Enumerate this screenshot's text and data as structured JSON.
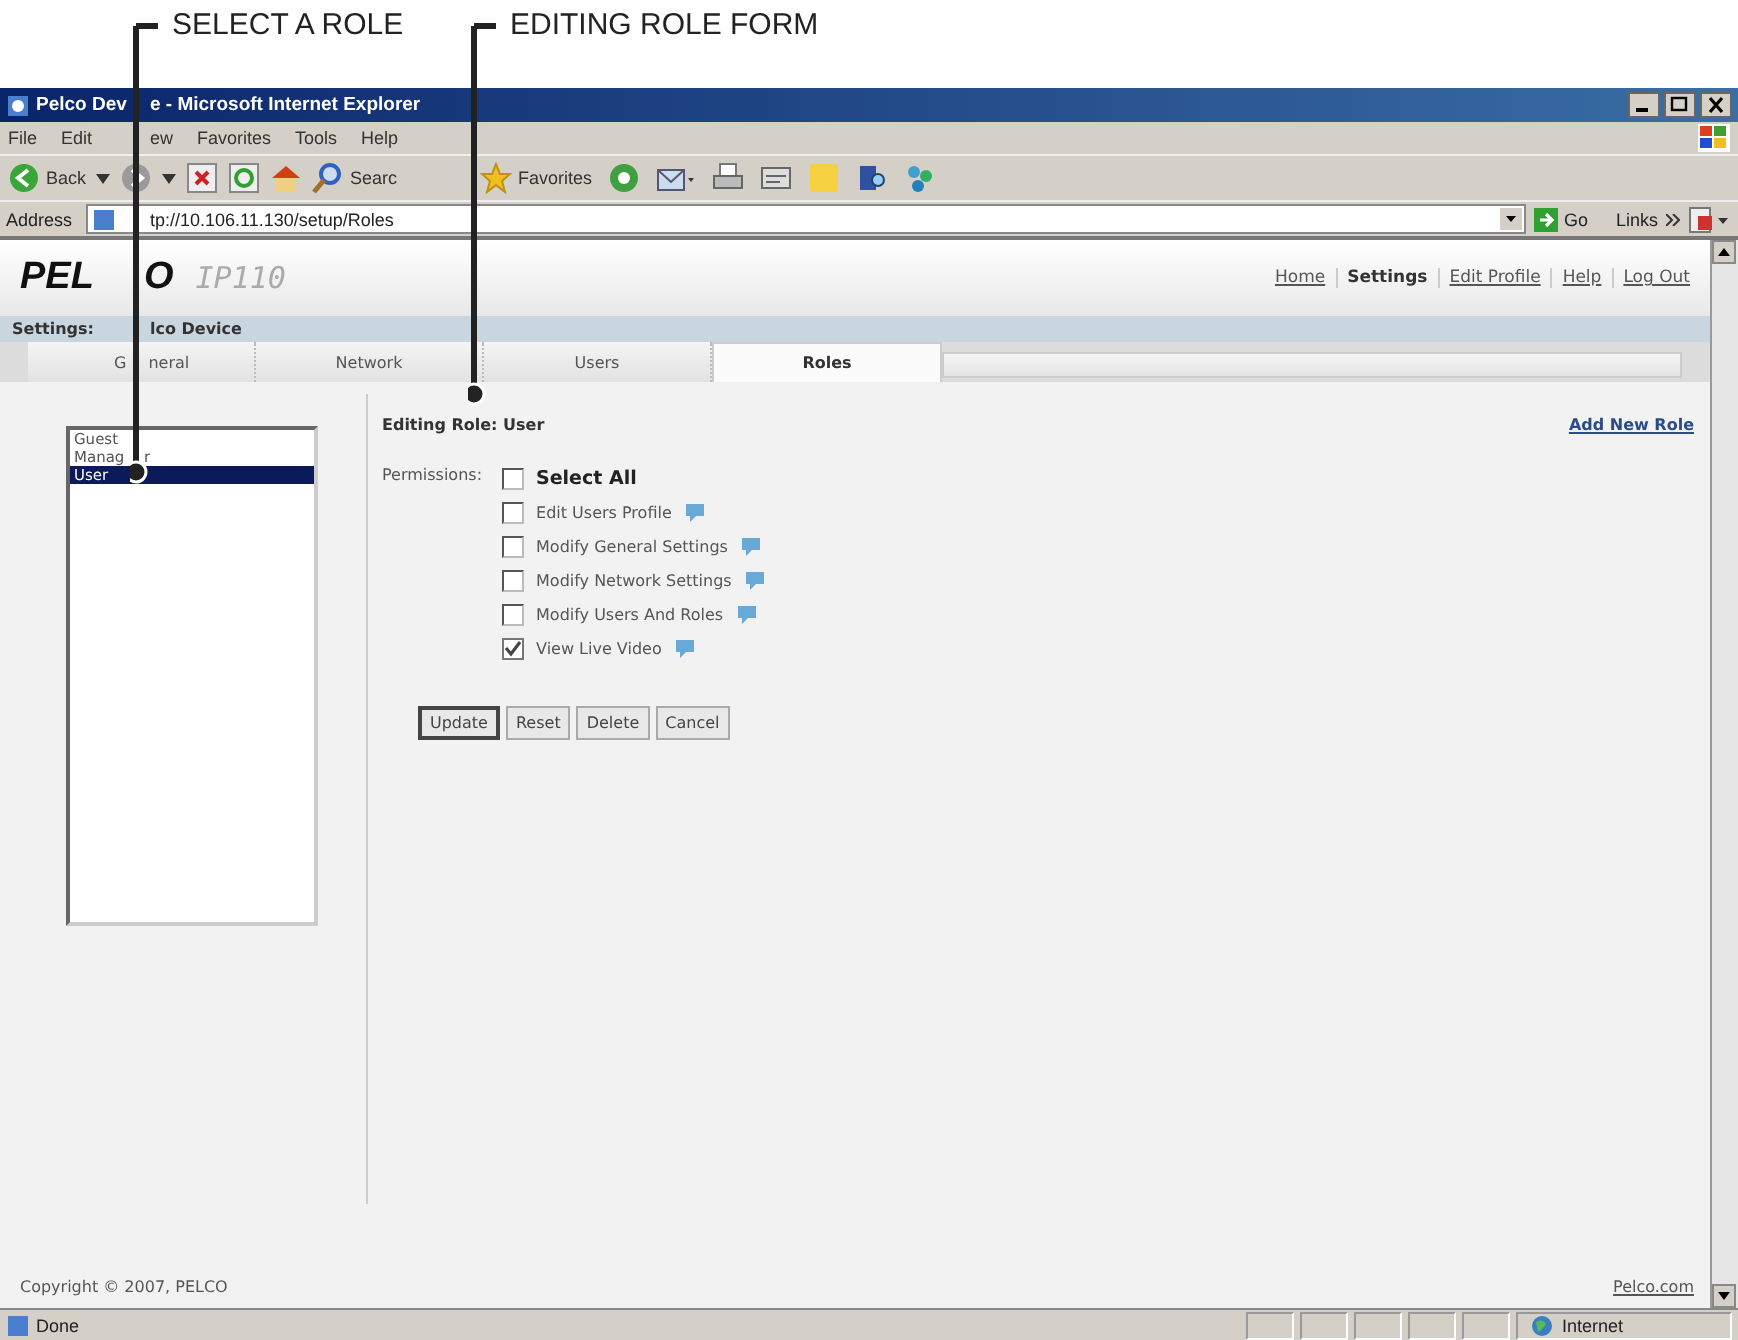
{
  "callouts": [
    {
      "label": "SELECT A ROLE"
    },
    {
      "label": "EDITING ROLE FORM"
    }
  ],
  "window": {
    "title": [
      "Pelco Dev",
      "e - Microsoft Internet Explorer"
    ]
  },
  "menu": [
    "File",
    "Edit",
    "ew",
    "Favorites",
    "Tools",
    "Help"
  ],
  "toolbar": {
    "back": "Back",
    "search": "Searc",
    "favorites": "Favorites"
  },
  "address": {
    "label": "Address",
    "value": "tp://10.106.11.130/setup/Roles",
    "go": "Go",
    "links": "Links"
  },
  "page": {
    "logo": [
      "PEL",
      "O"
    ],
    "model": "IP110",
    "nav": [
      {
        "label": "Home",
        "selected": false
      },
      {
        "label": "Settings",
        "selected": true
      },
      {
        "label": "Edit Profile",
        "selected": false
      },
      {
        "label": "Help",
        "selected": false
      },
      {
        "label": "Log Out",
        "selected": false
      }
    ],
    "breadcrumb": [
      "Settings:",
      "lco Device"
    ],
    "tabs": [
      {
        "text": [
          "G",
          "neral"
        ],
        "selected": false
      },
      {
        "text": [
          "Network"
        ],
        "selected": false
      },
      {
        "text": [
          "Users"
        ],
        "selected": false
      },
      {
        "text": [
          "Roles"
        ],
        "selected": true
      }
    ],
    "roles": [
      {
        "text": [
          "Guest"
        ],
        "selected": false
      },
      {
        "text": [
          "Manag",
          "r"
        ],
        "selected": false
      },
      {
        "text": [
          "User"
        ],
        "selected": true
      }
    ],
    "heading": "Editing Role: User",
    "add_role": "Add New Role",
    "permissions_label": "Permissions:",
    "permissions": [
      {
        "kind": "all",
        "label": "Select All",
        "checked": false
      },
      {
        "kind": "item",
        "label": "Edit Users Profile",
        "checked": false
      },
      {
        "kind": "item",
        "label": "Modify General Settings",
        "checked": false
      },
      {
        "kind": "item",
        "label": "Modify Network Settings",
        "checked": false
      },
      {
        "kind": "item",
        "label": "Modify Users And Roles",
        "checked": false
      },
      {
        "kind": "item",
        "label": "View Live Video",
        "checked": true
      }
    ],
    "buttons": [
      "Update",
      "Reset",
      "Delete",
      "Cancel"
    ],
    "copyright": "Copyright © 2007, PELCO",
    "footer_link": "Pelco.com"
  },
  "status_bar": {
    "text": "Done",
    "zone": "Internet"
  }
}
